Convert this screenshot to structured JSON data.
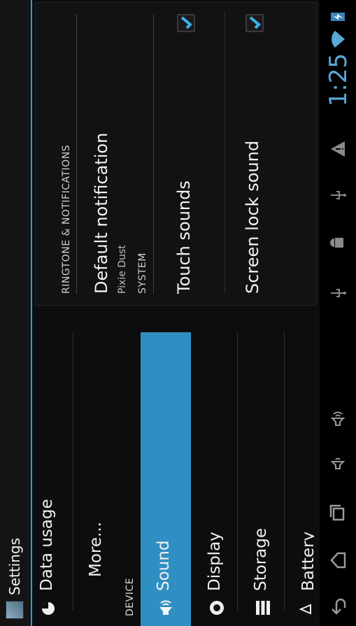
{
  "app": {
    "title": "Settings"
  },
  "left_list": {
    "items": [
      {
        "label": "Data usage"
      },
      {
        "label": "More..."
      }
    ],
    "device_header": "DEVICE",
    "device_items": [
      {
        "label": "Sound"
      },
      {
        "label": "Display"
      },
      {
        "label": "Storage"
      },
      {
        "label": "Battery"
      }
    ]
  },
  "panel": {
    "ringtone_header": "RINGTONE & NOTIFICATIONS",
    "default_notification_title": "Default notification",
    "default_notification_value": "Pixie Dust",
    "system_header": "SYSTEM",
    "touch_sounds_label": "Touch sounds",
    "screen_lock_sound_label": "Screen lock sound"
  },
  "status": {
    "time": "1:25"
  },
  "colors": {
    "accent": "#2a9fd6",
    "selected": "#2f8fc2"
  }
}
